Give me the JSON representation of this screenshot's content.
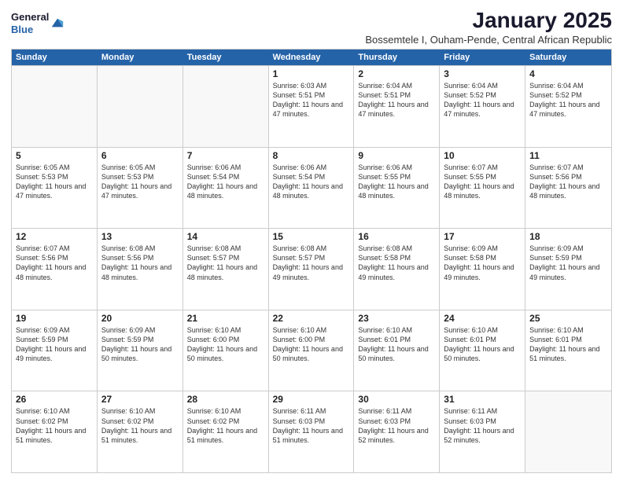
{
  "logo": {
    "general": "General",
    "blue": "Blue"
  },
  "title": "January 2025",
  "subtitle": "Bossemtele I, Ouham-Pende, Central African Republic",
  "header": {
    "days": [
      "Sunday",
      "Monday",
      "Tuesday",
      "Wednesday",
      "Thursday",
      "Friday",
      "Saturday"
    ]
  },
  "weeks": [
    [
      {
        "day": "",
        "empty": true
      },
      {
        "day": "",
        "empty": true
      },
      {
        "day": "",
        "empty": true
      },
      {
        "day": "1",
        "info": "Sunrise: 6:03 AM\nSunset: 5:51 PM\nDaylight: 11 hours and 47 minutes."
      },
      {
        "day": "2",
        "info": "Sunrise: 6:04 AM\nSunset: 5:51 PM\nDaylight: 11 hours and 47 minutes."
      },
      {
        "day": "3",
        "info": "Sunrise: 6:04 AM\nSunset: 5:52 PM\nDaylight: 11 hours and 47 minutes."
      },
      {
        "day": "4",
        "info": "Sunrise: 6:04 AM\nSunset: 5:52 PM\nDaylight: 11 hours and 47 minutes."
      }
    ],
    [
      {
        "day": "5",
        "info": "Sunrise: 6:05 AM\nSunset: 5:53 PM\nDaylight: 11 hours and 47 minutes."
      },
      {
        "day": "6",
        "info": "Sunrise: 6:05 AM\nSunset: 5:53 PM\nDaylight: 11 hours and 47 minutes."
      },
      {
        "day": "7",
        "info": "Sunrise: 6:06 AM\nSunset: 5:54 PM\nDaylight: 11 hours and 48 minutes."
      },
      {
        "day": "8",
        "info": "Sunrise: 6:06 AM\nSunset: 5:54 PM\nDaylight: 11 hours and 48 minutes."
      },
      {
        "day": "9",
        "info": "Sunrise: 6:06 AM\nSunset: 5:55 PM\nDaylight: 11 hours and 48 minutes."
      },
      {
        "day": "10",
        "info": "Sunrise: 6:07 AM\nSunset: 5:55 PM\nDaylight: 11 hours and 48 minutes."
      },
      {
        "day": "11",
        "info": "Sunrise: 6:07 AM\nSunset: 5:56 PM\nDaylight: 11 hours and 48 minutes."
      }
    ],
    [
      {
        "day": "12",
        "info": "Sunrise: 6:07 AM\nSunset: 5:56 PM\nDaylight: 11 hours and 48 minutes."
      },
      {
        "day": "13",
        "info": "Sunrise: 6:08 AM\nSunset: 5:56 PM\nDaylight: 11 hours and 48 minutes."
      },
      {
        "day": "14",
        "info": "Sunrise: 6:08 AM\nSunset: 5:57 PM\nDaylight: 11 hours and 48 minutes."
      },
      {
        "day": "15",
        "info": "Sunrise: 6:08 AM\nSunset: 5:57 PM\nDaylight: 11 hours and 49 minutes."
      },
      {
        "day": "16",
        "info": "Sunrise: 6:08 AM\nSunset: 5:58 PM\nDaylight: 11 hours and 49 minutes."
      },
      {
        "day": "17",
        "info": "Sunrise: 6:09 AM\nSunset: 5:58 PM\nDaylight: 11 hours and 49 minutes."
      },
      {
        "day": "18",
        "info": "Sunrise: 6:09 AM\nSunset: 5:59 PM\nDaylight: 11 hours and 49 minutes."
      }
    ],
    [
      {
        "day": "19",
        "info": "Sunrise: 6:09 AM\nSunset: 5:59 PM\nDaylight: 11 hours and 49 minutes."
      },
      {
        "day": "20",
        "info": "Sunrise: 6:09 AM\nSunset: 5:59 PM\nDaylight: 11 hours and 50 minutes."
      },
      {
        "day": "21",
        "info": "Sunrise: 6:10 AM\nSunset: 6:00 PM\nDaylight: 11 hours and 50 minutes."
      },
      {
        "day": "22",
        "info": "Sunrise: 6:10 AM\nSunset: 6:00 PM\nDaylight: 11 hours and 50 minutes."
      },
      {
        "day": "23",
        "info": "Sunrise: 6:10 AM\nSunset: 6:01 PM\nDaylight: 11 hours and 50 minutes."
      },
      {
        "day": "24",
        "info": "Sunrise: 6:10 AM\nSunset: 6:01 PM\nDaylight: 11 hours and 50 minutes."
      },
      {
        "day": "25",
        "info": "Sunrise: 6:10 AM\nSunset: 6:01 PM\nDaylight: 11 hours and 51 minutes."
      }
    ],
    [
      {
        "day": "26",
        "info": "Sunrise: 6:10 AM\nSunset: 6:02 PM\nDaylight: 11 hours and 51 minutes."
      },
      {
        "day": "27",
        "info": "Sunrise: 6:10 AM\nSunset: 6:02 PM\nDaylight: 11 hours and 51 minutes."
      },
      {
        "day": "28",
        "info": "Sunrise: 6:10 AM\nSunset: 6:02 PM\nDaylight: 11 hours and 51 minutes."
      },
      {
        "day": "29",
        "info": "Sunrise: 6:11 AM\nSunset: 6:03 PM\nDaylight: 11 hours and 51 minutes."
      },
      {
        "day": "30",
        "info": "Sunrise: 6:11 AM\nSunset: 6:03 PM\nDaylight: 11 hours and 52 minutes."
      },
      {
        "day": "31",
        "info": "Sunrise: 6:11 AM\nSunset: 6:03 PM\nDaylight: 11 hours and 52 minutes."
      },
      {
        "day": "",
        "empty": true
      }
    ]
  ]
}
